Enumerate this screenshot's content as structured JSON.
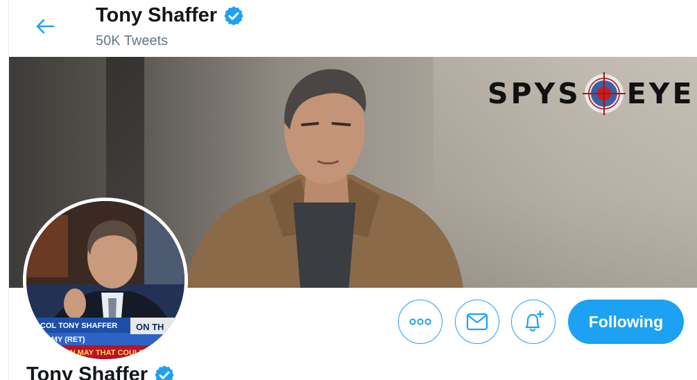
{
  "header": {
    "name": "Tony Shaffer",
    "tweet_count": "50K Tweets",
    "verified": true
  },
  "banner": {
    "logo_text_left": "SPYS",
    "logo_text_right": "EYE"
  },
  "avatar": {
    "caption_line1": "COL TONY SHAFFER",
    "caption_line2": "ARMY (RET)",
    "ticker_tag": "ON TH",
    "ticker_text": "GHTER IN MAY THAT COULD B"
  },
  "actions": {
    "follow_label": "Following"
  },
  "profile": {
    "name": "Tony Shaffer"
  },
  "colors": {
    "accent": "#1da1f2",
    "text_primary": "#14171a",
    "text_secondary": "#657786"
  },
  "icons": {
    "back": "arrow-left-icon",
    "verified": "verified-badge-icon",
    "more": "more-dots-icon",
    "message": "envelope-icon",
    "notify": "bell-plus-icon"
  }
}
